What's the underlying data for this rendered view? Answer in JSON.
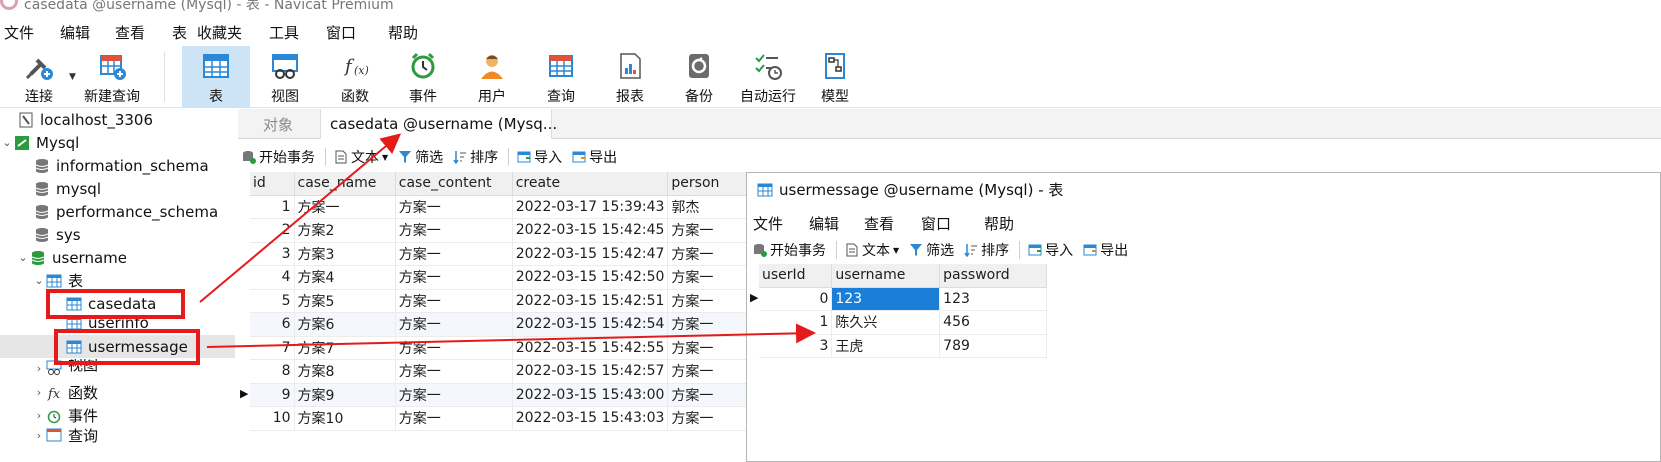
{
  "window": {
    "title": "casedata @username (Mysql) - 表 - Navicat Premium"
  },
  "menu": [
    "文件",
    "编辑",
    "查看",
    "表",
    "收藏夹",
    "工具",
    "窗口",
    "帮助"
  ],
  "toolbar": {
    "connect": "连接",
    "new_query": "新建查询",
    "table": "表",
    "view": "视图",
    "function": "函数",
    "event": "事件",
    "user": "用户",
    "query": "查询",
    "report": "报表",
    "backup": "备份",
    "automation": "自动运行",
    "model": "模型"
  },
  "sidebar": {
    "connection": "localhost_3306",
    "mysql": "Mysql",
    "schemas": [
      "information_schema",
      "mysql",
      "performance_schema",
      "sys"
    ],
    "db": "username",
    "tables_group": "表",
    "tables": [
      "casedata",
      "userinfo",
      "usermessage"
    ],
    "views_group": "视图",
    "functions_group": "函数",
    "events_group": "事件",
    "queries_group": "查询"
  },
  "tabs": {
    "objects": "对象",
    "active": "casedata @username (Mysq..."
  },
  "subtoolbar": {
    "begin_tx": "开始事务",
    "text": "文本",
    "filter": "筛选",
    "sort": "排序",
    "import": "导入",
    "export": "导出"
  },
  "casedata": {
    "columns": [
      "id",
      "case_name",
      "case_content",
      "create",
      "person"
    ],
    "rows": [
      [
        "1",
        "方案一",
        "方案一",
        "2022-03-17 15:39:43",
        "郭杰"
      ],
      [
        "2",
        "方案2",
        "方案一",
        "2022-03-15 15:42:45",
        "方案一"
      ],
      [
        "3",
        "方案3",
        "方案一",
        "2022-03-15 15:42:47",
        "方案一"
      ],
      [
        "4",
        "方案4",
        "方案一",
        "2022-03-15 15:42:50",
        "方案一"
      ],
      [
        "5",
        "方案5",
        "方案一",
        "2022-03-15 15:42:51",
        "方案一"
      ],
      [
        "6",
        "方案6",
        "方案一",
        "2022-03-15 15:42:54",
        "方案一"
      ],
      [
        "7",
        "方案7",
        "方案一",
        "2022-03-15 15:42:55",
        "方案一"
      ],
      [
        "8",
        "方案8",
        "方案一",
        "2022-03-15 15:42:57",
        "方案一"
      ],
      [
        "9",
        "方案9",
        "方案一",
        "2022-03-15 15:43:00",
        "方案一"
      ],
      [
        "10",
        "方案10",
        "方案一",
        "2022-03-15 15:43:03",
        "方案一"
      ]
    ]
  },
  "subwindow": {
    "title": "usermessage @username (Mysql) - 表",
    "menu": [
      "文件",
      "编辑",
      "查看",
      "窗口",
      "帮助"
    ],
    "columns": [
      "userId",
      "username",
      "password"
    ],
    "rows": [
      [
        "0",
        "123",
        "123"
      ],
      [
        "1",
        "陈久兴",
        "456"
      ],
      [
        "3",
        "王虎",
        "789"
      ]
    ]
  },
  "colors": {
    "annotation": "#e51b1b",
    "selection": "#1b7fd8",
    "active_tool": "#cde3f6"
  }
}
